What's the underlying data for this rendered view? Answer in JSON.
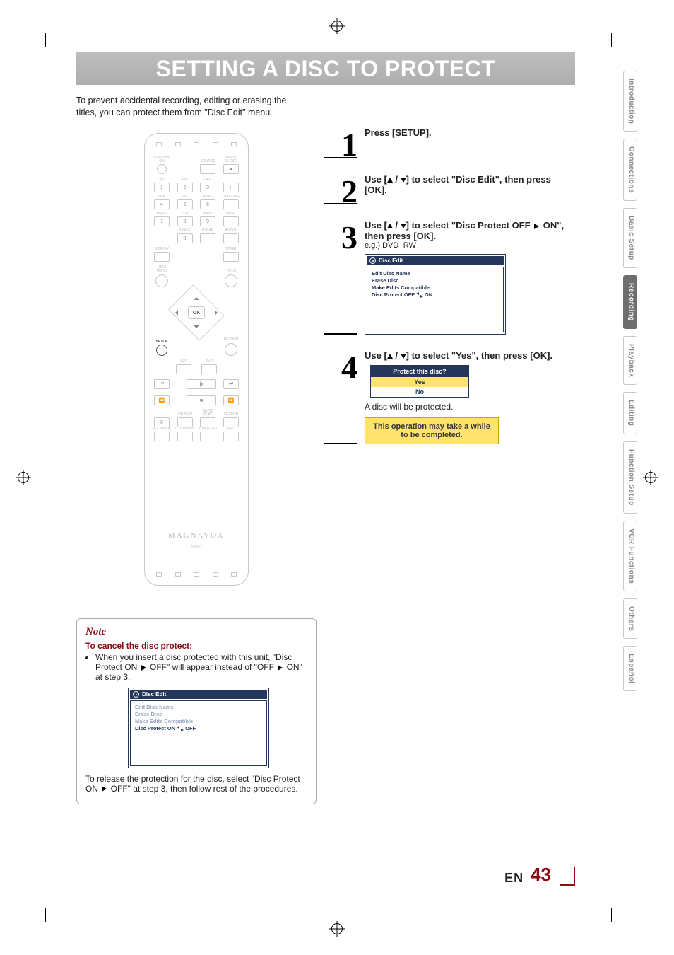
{
  "title": "SETTING A DISC TO PROTECT",
  "intro": "To prevent accidental recording, editing or erasing the titles, you can protect them from \"Disc Edit\" menu.",
  "remote": {
    "brand": "MAGNAVOX",
    "model": "NB887",
    "row1": [
      "STANDBY-ON",
      "",
      "SOURCE",
      "OPEN/\nCLOSE"
    ],
    "eject": "▲",
    "num_labels": [
      ".@/:",
      "ABC",
      "DEF",
      "",
      "GHI",
      "JKL",
      "MNO",
      "TRACKING",
      "PQRS",
      "TUV",
      "WXYZ",
      "HDMI",
      "",
      "SPACE",
      "CLEAR",
      "AUDIO"
    ],
    "nums": [
      "1",
      "2",
      "3",
      "+",
      "4",
      "5",
      "6",
      "−",
      "7",
      "8",
      "9",
      "",
      "",
      "0",
      "",
      ""
    ],
    "display": "DISPLAY",
    "timer": "TIMER",
    "discmenu": "DISC MENU",
    "title_btn": "TITLE",
    "ok": "OK",
    "setup": "SETUP",
    "return": "RETURN",
    "mode": [
      "VCR",
      "DVD"
    ],
    "transport": [
      "⏮",
      "▶",
      "⏭",
      "⏪",
      "■",
      "⏩"
    ],
    "row_btm1": [
      "⏸",
      "CM SKIP",
      "RAPID PLAY",
      "SEARCH"
    ],
    "row_btm2": [
      "REC MODE",
      "D.DUBBING",
      "TIMER SET",
      "REC"
    ]
  },
  "steps": {
    "s1": {
      "n": "1",
      "text": "Press [SETUP]."
    },
    "s2": {
      "n": "2",
      "pre": "Use [",
      "mid": "] to select \"Disc Edit\", then press [OK]."
    },
    "s3": {
      "n": "3",
      "pre": "Use [",
      "mid": "] to select \"Disc Protect OFF ",
      "mid2": " ON\", then press [OK].",
      "eg": "e.g.) DVD+RW"
    },
    "s4": {
      "n": "4",
      "pre": "Use [",
      "mid": "] to select \"Yes\", then press [OK].",
      "caption": "A disc will be protected.",
      "warn": "This operation may take a while to be completed."
    }
  },
  "osd1": {
    "title": "Disc Edit",
    "items": [
      "Edit Disc Name",
      "Erase Disc",
      "Make Edits Compatible"
    ],
    "current": {
      "pre": "Disc Protect OFF",
      "post": "ON"
    }
  },
  "yesno": {
    "title": "Protect this disc?",
    "yes": "Yes",
    "no": "No"
  },
  "note": {
    "heading": "Note",
    "sub": "To cancel the disc protect:",
    "bullet_pt": "When you insert a disc protected with this unit, \"Disc Protect ON ",
    "bullet_mid": " OFF\" will appear instead of \"OFF ",
    "bullet_end": " ON\" at step 3.",
    "osd": {
      "title": "Disc Edit",
      "dim": [
        "Edit Disc Name",
        "Erase Disc",
        "Make Edits Compatible"
      ],
      "current": {
        "pre": "Disc Protect ON",
        "post": "OFF"
      }
    },
    "after_pre": "To release the protection for the disc, select \"Disc Protect ON ",
    "after_post": " OFF\" at step 3, then follow rest of the procedures."
  },
  "tabs": [
    "Introduction",
    "Connections",
    "Basic Setup",
    "Recording",
    "Playback",
    "Editing",
    "Function Setup",
    "VCR Functions",
    "Others",
    "Español"
  ],
  "active_tab": "Recording",
  "footer": {
    "lang": "EN",
    "page": "43"
  }
}
